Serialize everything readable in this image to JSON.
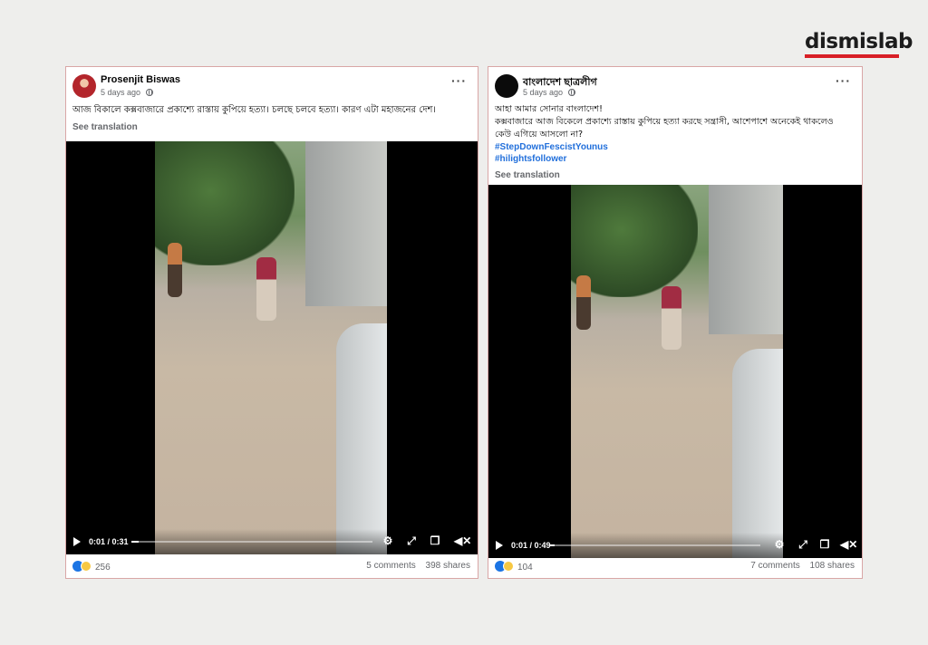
{
  "brand": {
    "logo_text": "dismislab"
  },
  "posts": [
    {
      "author": "Prosenjit Biswas",
      "time": "5 days ago",
      "text_lines": [
        "আজ বিকালে কক্সবাজারে প্রকাশ্যে রাস্তায় কুপিয়ে হত্যা। চলছে চলবে হত্যা। কারণ এটা মহাজনের দেশ।"
      ],
      "hashtags": [],
      "see_translation": "See translation",
      "video": {
        "current_time": "0:01",
        "duration": "0:31",
        "progress": 0.03
      },
      "reaction_count": "256",
      "comments": "5 comments",
      "shares": "398 shares"
    },
    {
      "author": "বাংলাদেশ ছাত্রলীগ",
      "time": "5 days ago",
      "text_lines": [
        "আহা আমার সোনার বাংলাদেশ!",
        "কক্সবাজারে আজ বিকেলে প্রকাশ্যে রাস্তায় কুপিয়ে হত্যা করছে সন্ত্রাসী, আশেপাশে অনেকেই থাকলেও",
        "কেউ এগিয়ে আসলো না?"
      ],
      "hashtags": [
        "#StepDownFescistYounus",
        "#hilightsfollower"
      ],
      "see_translation": "See translation",
      "video": {
        "current_time": "0:01",
        "duration": "0:49",
        "progress": 0.02
      },
      "reaction_count": "104",
      "comments": "7 comments",
      "shares": "108 shares"
    }
  ],
  "icons": {
    "more": "more-options-icon",
    "globe": "globe-icon",
    "play": "play-icon",
    "settings": "gear-icon",
    "expand": "expand-icon",
    "pip": "picture-in-picture-icon",
    "mute": "volume-muted-icon",
    "like": "like-reaction-icon",
    "sad": "sad-reaction-icon"
  },
  "colors": {
    "brand_red": "#d81f26",
    "hashtag_blue": "#216fdb",
    "like_blue": "#1b74e4"
  }
}
